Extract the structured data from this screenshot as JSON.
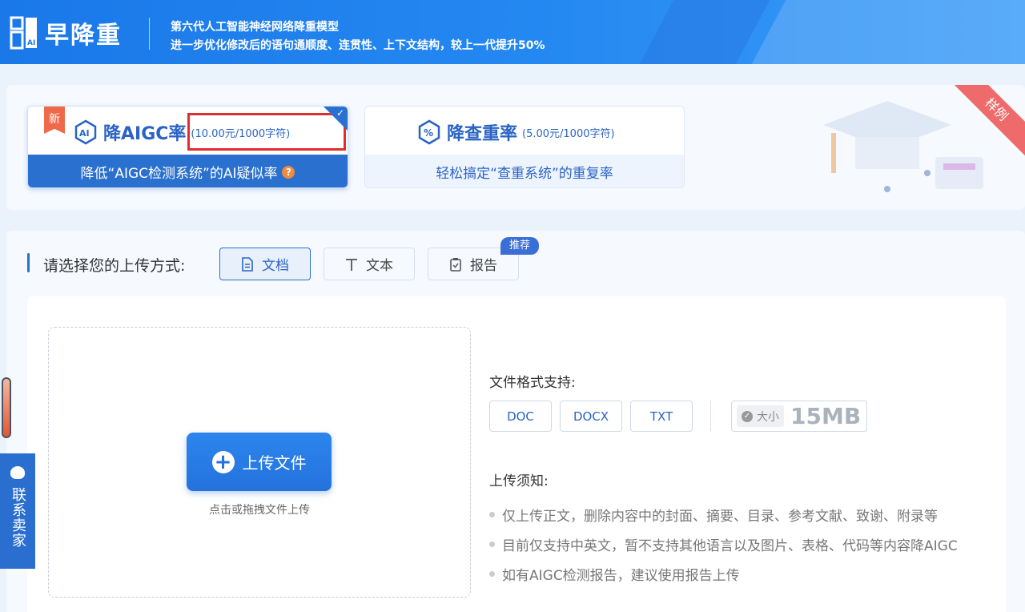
{
  "header": {
    "brand": "早降重",
    "tagline_line1": "第六代人工智能神经网络降重模型",
    "tagline_line2": "进一步优化修改后的语句通顺度、连贯性、上下文结构，较上一代提升50%"
  },
  "services": {
    "aigc": {
      "badge": "新",
      "title": "降AIGC率",
      "price": "(10.00元/1000字符)",
      "description": "降低“AIGC检测系统”的AI疑似率",
      "help_icon": "question-icon",
      "selected": true
    },
    "duplicate": {
      "title": "降查重率",
      "price": "(5.00元/1000字符)",
      "description": "轻松搞定“查重系统”的重复率"
    },
    "sample_ribbon": "样例"
  },
  "upload": {
    "method_label": "请选择您的上传方式:",
    "methods": [
      {
        "label": "文档",
        "icon": "document-icon",
        "active": true
      },
      {
        "label": "文本",
        "icon": "text-icon",
        "active": false
      },
      {
        "label": "报告",
        "icon": "clipboard-icon",
        "active": false
      }
    ],
    "recommend_badge": "推荐",
    "upload_button": "上传文件",
    "drop_hint": "点击或拖拽文件上传",
    "format_title": "文件格式支持:",
    "formats": [
      "DOC",
      "DOCX",
      "TXT"
    ],
    "size_label": "大小",
    "size_value": "15MB",
    "notice_title": "上传须知:",
    "notices": [
      "仅上传正文，删除内容中的封面、摘要、目录、参考文献、致谢、附录等",
      "目前仅支持中英文，暂不支持其他语言以及图片、表格、代码等内容降AIGC",
      "如有AIGC检测报告，建议使用报告上传"
    ]
  },
  "contact": {
    "label": "联系卖家"
  },
  "colors": {
    "brand_blue": "#2a70cf",
    "header_blue": "#1a78e8",
    "highlight_red": "#e02e2e",
    "new_badge": "#ee6a4b"
  }
}
